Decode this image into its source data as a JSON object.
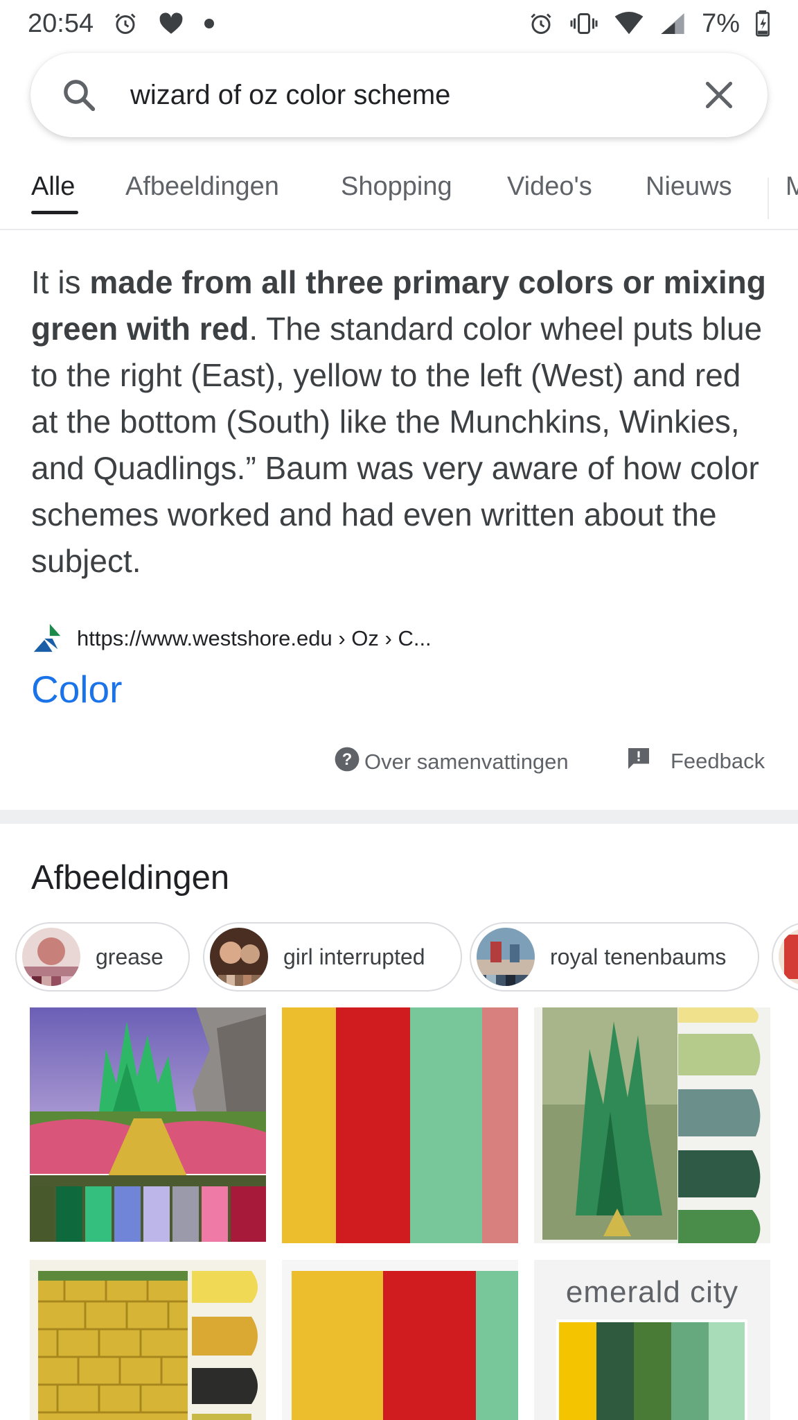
{
  "status_bar": {
    "time": "20:54",
    "battery": "7%",
    "icons": [
      "alarm-icon",
      "heart-app-icon",
      "notification-dot-icon",
      "alarm-icon",
      "vibrate-icon",
      "wifi-icon",
      "signal-icon",
      "battery-icon"
    ]
  },
  "search": {
    "query": "wizard of oz color scheme",
    "icons": [
      "search-icon",
      "close-icon"
    ]
  },
  "tabs": [
    {
      "label": "Alle",
      "active": true
    },
    {
      "label": "Afbeeldingen",
      "active": false
    },
    {
      "label": "Shopping",
      "active": false
    },
    {
      "label": "Video's",
      "active": false
    },
    {
      "label": "Nieuws",
      "active": false
    },
    {
      "label": "M",
      "active": false
    }
  ],
  "answer": {
    "prefix": "It is ",
    "bold": "made from all three primary colors or mixing green with red",
    "suffix": ". The standard color wheel puts blue to the right (East), yellow to the left (West) and red at the bottom (South) like the Munchkins, Winkies, and Quadlings.” Baum was very aware of how color schemes worked and had even written about the subject."
  },
  "source": {
    "url": "https://www.westshore.edu › Oz › C...",
    "title": "Color"
  },
  "about": {
    "about_label": "Over samenvattingen",
    "feedback_label": "Feedback"
  },
  "images_section": {
    "heading": "Afbeeldingen",
    "chips": [
      {
        "label": "grease"
      },
      {
        "label": "girl interrupted"
      },
      {
        "label": "royal tenenbaums"
      }
    ],
    "tile_text": "emerald city"
  },
  "colors": {
    "link_blue": "#1a73e8",
    "palette_gold": "#ecbd2c",
    "palette_red": "#d01c1f",
    "palette_green": "#77c79a",
    "palette_pink": "#d7807d"
  }
}
